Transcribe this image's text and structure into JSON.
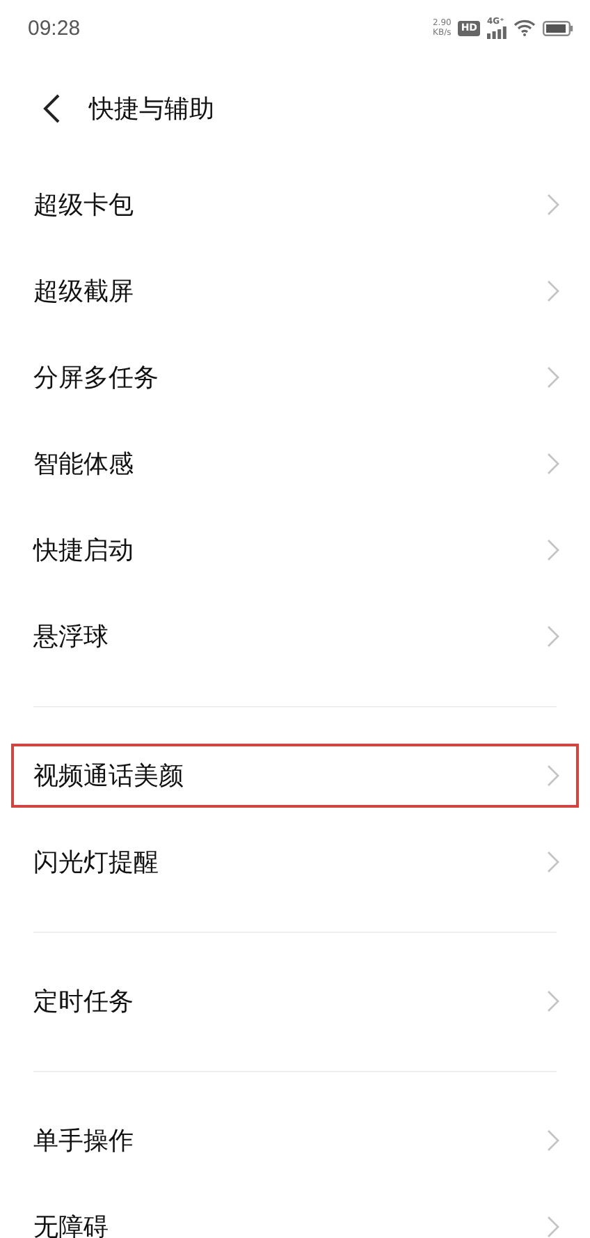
{
  "status_bar": {
    "time": "09:28",
    "speed": "2.90",
    "speed_unit": "KB/s",
    "hd": "HD",
    "network": "4G⁺"
  },
  "header": {
    "title": "快捷与辅助"
  },
  "groups": [
    {
      "items": [
        {
          "label": "超级卡包",
          "highlighted": false
        },
        {
          "label": "超级截屏",
          "highlighted": false
        },
        {
          "label": "分屏多任务",
          "highlighted": false
        },
        {
          "label": "智能体感",
          "highlighted": false
        },
        {
          "label": "快捷启动",
          "highlighted": false
        },
        {
          "label": "悬浮球",
          "highlighted": false
        }
      ]
    },
    {
      "items": [
        {
          "label": "视频通话美颜",
          "highlighted": true
        },
        {
          "label": "闪光灯提醒",
          "highlighted": false
        }
      ]
    },
    {
      "items": [
        {
          "label": "定时任务",
          "highlighted": false
        }
      ]
    },
    {
      "items": [
        {
          "label": "单手操作",
          "highlighted": false
        },
        {
          "label": "无障碍",
          "highlighted": false
        }
      ]
    }
  ]
}
